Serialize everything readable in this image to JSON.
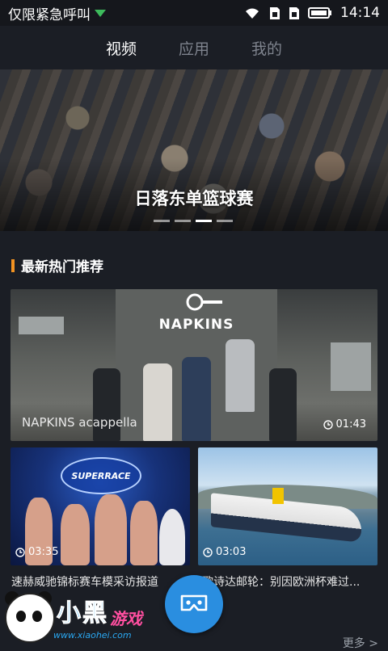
{
  "status_bar": {
    "carrier": "仅限紧急呼叫",
    "time": "14:14",
    "icons": [
      "signal-down-icon",
      "wifi-icon",
      "sim-card-icon",
      "sim-card-icon",
      "battery-icon"
    ]
  },
  "top_nav": {
    "tabs": [
      {
        "label": "视频",
        "active": true
      },
      {
        "label": "应用",
        "active": false
      },
      {
        "label": "我的",
        "active": false
      }
    ]
  },
  "banner": {
    "caption": "日落东单篮球赛",
    "slide_count": 4,
    "active_index": 2
  },
  "section": {
    "title": "最新热门推荐",
    "accent_color": "#f29322",
    "more_label": "更多 >"
  },
  "videos": [
    {
      "title": "NAPKINS acappella",
      "duration": "01:43",
      "logo_text": "NAPKINS"
    },
    {
      "title": "速赫威驰锦标赛车模采访报道",
      "duration": "03:35",
      "badge_text": "SUPERRACE"
    },
    {
      "title": "歌诗达邮轮：别因欧洲杯难过...",
      "duration": "03:03"
    }
  ],
  "fab": {
    "icon": "vr-headset-icon",
    "color": "#2a8ee0"
  },
  "watermark": {
    "brand": "小黑",
    "brand2": "游戏",
    "url": "www.xiaohei.com"
  }
}
